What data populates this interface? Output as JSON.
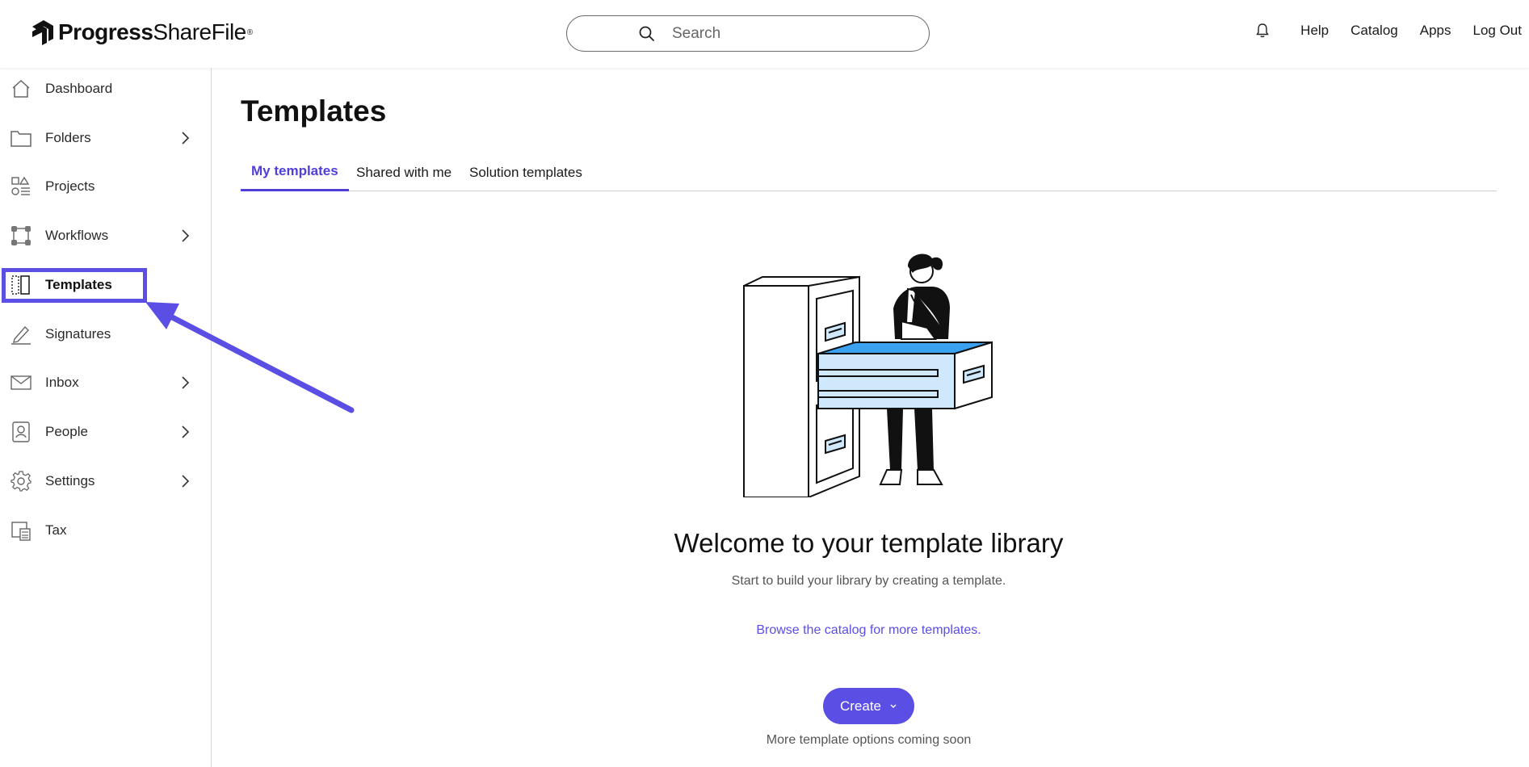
{
  "header": {
    "logo_brand": "Progress",
    "logo_product": "ShareFile",
    "logo_reg": "®",
    "search_placeholder": "Search",
    "nav": [
      "Help",
      "Catalog",
      "Apps",
      "Log Out"
    ]
  },
  "sidebar": {
    "items": [
      {
        "label": "Dashboard",
        "icon": "home-icon",
        "has_chevron": false
      },
      {
        "label": "Folders",
        "icon": "folder-icon",
        "has_chevron": true
      },
      {
        "label": "Projects",
        "icon": "shapes-icon",
        "has_chevron": false
      },
      {
        "label": "Workflows",
        "icon": "workflow-icon",
        "has_chevron": true
      },
      {
        "label": "Templates",
        "icon": "template-icon",
        "has_chevron": false,
        "active": true
      },
      {
        "label": "Signatures",
        "icon": "pen-icon",
        "has_chevron": false
      },
      {
        "label": "Inbox",
        "icon": "mail-icon",
        "has_chevron": true
      },
      {
        "label": "People",
        "icon": "contact-icon",
        "has_chevron": true
      },
      {
        "label": "Settings",
        "icon": "gear-icon",
        "has_chevron": true
      },
      {
        "label": "Tax",
        "icon": "calculator-icon",
        "has_chevron": false
      }
    ]
  },
  "main": {
    "title": "Templates",
    "tabs": [
      "My templates",
      "Shared with me",
      "Solution templates"
    ],
    "active_tab": "My templates",
    "welcome_title": "Welcome to your template library",
    "welcome_sub": "Start to build your library by creating a template.",
    "browse_link": "Browse the catalog for more templates.",
    "create_label": "Create",
    "more_note": "More template options coming soon"
  },
  "colors": {
    "accent": "#5a4ee4",
    "drawer_blue": "#3aa2f0",
    "drawer_light": "#cfe8fb"
  }
}
